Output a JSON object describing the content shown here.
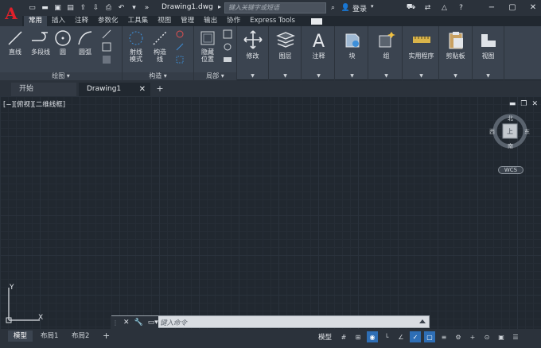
{
  "titlebar": {
    "logo": "A",
    "doc_title": "Drawing1.dwg",
    "search_placeholder": "键入关键字或短语",
    "login": "登录"
  },
  "ribbon_tabs": [
    "常用",
    "插入",
    "注释",
    "参数化",
    "工具集",
    "视图",
    "管理",
    "输出",
    "协作",
    "Express Tools"
  ],
  "ribbon": {
    "draw": {
      "line": "直线",
      "polyline": "多段线",
      "circle": "圆",
      "arc": "圆弧",
      "footer": "绘图 ▾"
    },
    "construct": {
      "ray": "射线\n模式",
      "xline": "构造\n线",
      "footer": "构造 ▾"
    },
    "local": {
      "hide": "隐藏\n位置",
      "footer": "局部 ▾"
    },
    "modify": "修改",
    "layers": "图层",
    "annotation": "注释",
    "block": "块",
    "groups": "组",
    "utilities": "实用程序",
    "clipboard": "剪贴板",
    "view": "视图"
  },
  "filetabs": {
    "start": "开始",
    "drawing": "Drawing1"
  },
  "canvas": {
    "viewport_label": "[−][俯视][二维线框]",
    "viewcube": {
      "north": "北",
      "south": "南",
      "east": "东",
      "west": "西",
      "top": "上",
      "wcs": "WCS"
    },
    "ucs_y": "Y",
    "ucs_x": "X"
  },
  "cmdline": {
    "placeholder": "键入命令"
  },
  "statusbar": {
    "layouts": [
      "模型",
      "布局1",
      "布局2"
    ],
    "model": "模型"
  },
  "colors": {
    "accent": "#2e6eb5",
    "logo": "#e0202a",
    "canvas": "#212830"
  }
}
